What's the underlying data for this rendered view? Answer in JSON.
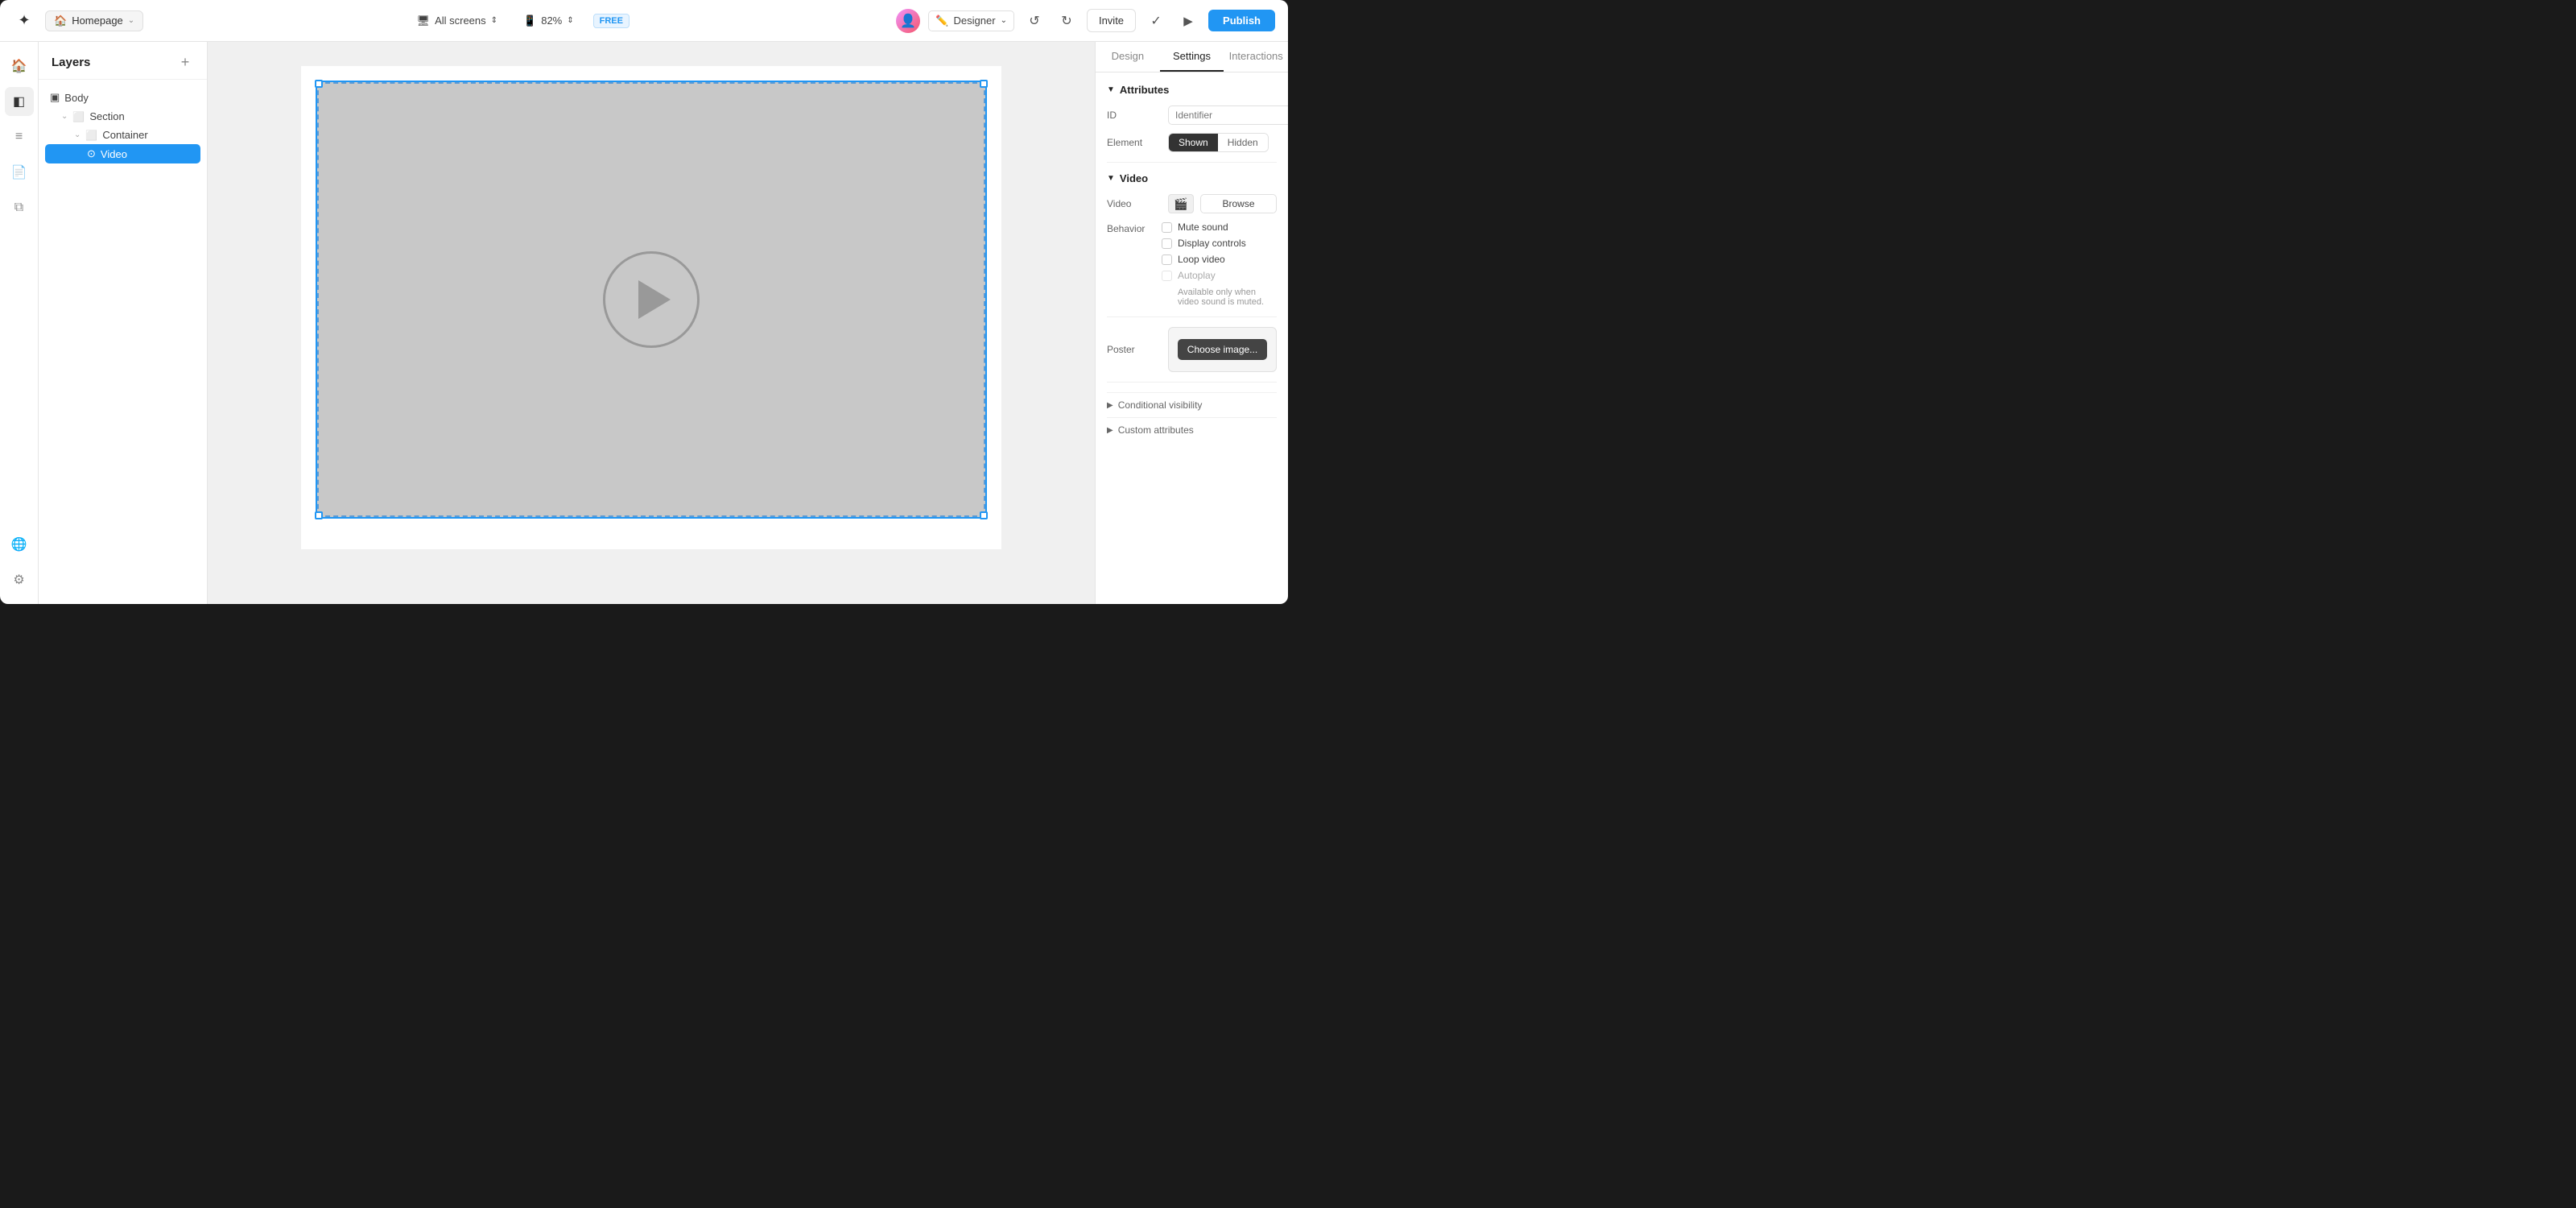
{
  "app": {
    "logo": "✦"
  },
  "topbar": {
    "breadcrumb_icon": "🏠",
    "breadcrumb_label": "Homepage",
    "breadcrumb_caret": "⌄",
    "screen_label": "All screens",
    "screen_caret": "⇕",
    "zoom_icon": "📱",
    "zoom_label": "82%",
    "zoom_caret": "⇕",
    "free_badge": "FREE",
    "avatar_text": "👤",
    "designer_label": "Designer",
    "designer_caret": "⌄",
    "undo_icon": "↺",
    "redo_icon": "↻",
    "invite_label": "Invite",
    "check_icon": "✓",
    "play_icon": "▶",
    "publish_label": "Publish"
  },
  "sidebar": {
    "items": [
      {
        "icon": "🏠",
        "label": "home"
      },
      {
        "icon": "◧",
        "label": "layers"
      },
      {
        "icon": "≡",
        "label": "pages"
      },
      {
        "icon": "📄",
        "label": "assets"
      },
      {
        "icon": "⧉",
        "label": "components"
      },
      {
        "icon": "🌐",
        "label": "global"
      },
      {
        "icon": "⚙",
        "label": "settings"
      }
    ]
  },
  "layers": {
    "title": "Layers",
    "add_icon": "+",
    "tree": [
      {
        "id": "body",
        "label": "Body",
        "icon": "▣",
        "indent": 0
      },
      {
        "id": "section",
        "label": "Section",
        "icon": "⬜",
        "indent": 1,
        "chevron": "⌄"
      },
      {
        "id": "container",
        "label": "Container",
        "icon": "⬜",
        "indent": 2,
        "chevron": "⌄"
      },
      {
        "id": "video",
        "label": "Video",
        "icon": "⊙",
        "indent": 3,
        "selected": true
      }
    ]
  },
  "canvas": {
    "video_placeholder_icon": "▶"
  },
  "right_panel": {
    "tabs": [
      {
        "id": "design",
        "label": "Design"
      },
      {
        "id": "settings",
        "label": "Settings",
        "active": true
      },
      {
        "id": "interactions",
        "label": "Interactions"
      }
    ],
    "attributes_section": "Attributes",
    "id_label": "ID",
    "id_placeholder": "Identifier",
    "element_label": "Element",
    "shown_label": "Shown",
    "hidden_label": "Hidden",
    "video_section": "Video",
    "video_label": "Video",
    "video_icon": "🎬",
    "browse_label": "Browse",
    "behavior_label": "Behavior",
    "mute_sound_label": "Mute sound",
    "display_controls_label": "Display controls",
    "loop_video_label": "Loop video",
    "autoplay_label": "Autoplay",
    "autoplay_note": "Available only when video sound is muted.",
    "poster_label": "Poster",
    "choose_image_label": "Choose image...",
    "conditional_visibility_label": "Conditional visibility",
    "custom_attributes_label": "Custom attributes"
  }
}
